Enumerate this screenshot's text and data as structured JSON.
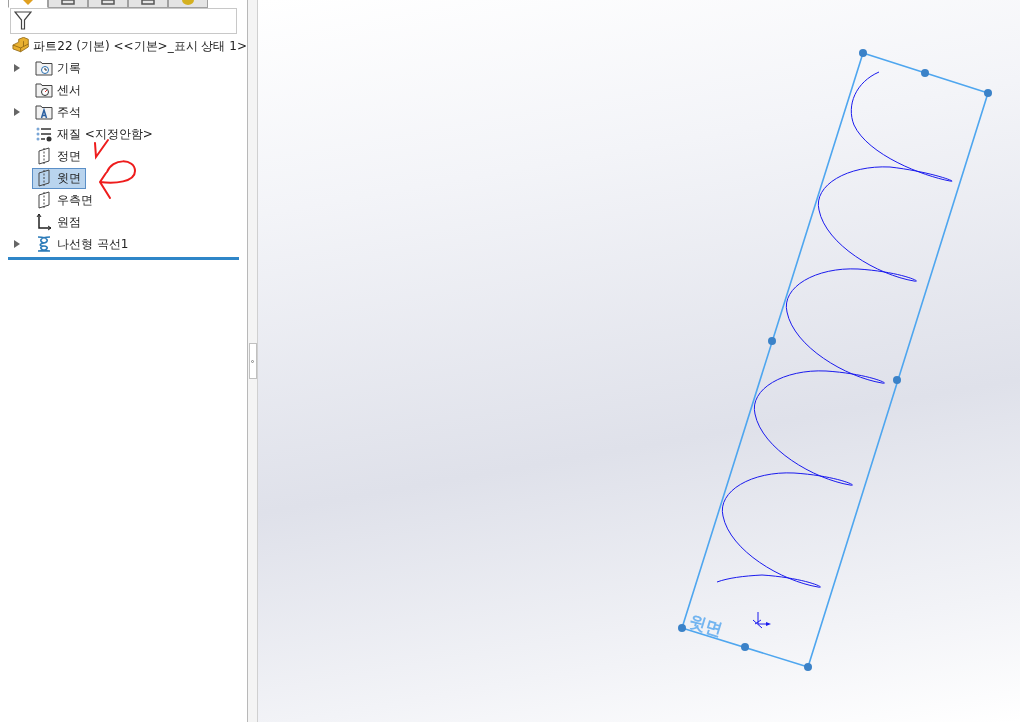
{
  "panel_tabs": [
    {
      "kind": "features",
      "selected": true
    },
    {
      "kind": "properties",
      "selected": false
    },
    {
      "kind": "config",
      "selected": false
    },
    {
      "kind": "dim",
      "selected": false
    },
    {
      "kind": "display",
      "selected": false
    }
  ],
  "tree": {
    "root": {
      "label": "파트22 (기본) <<기본>_표시 상태 1>"
    },
    "items": [
      {
        "label": "기록",
        "kind": "history",
        "expandable": true,
        "selected": false
      },
      {
        "label": "센서",
        "kind": "sensor",
        "expandable": false,
        "selected": false
      },
      {
        "label": "주석",
        "kind": "annotation",
        "expandable": true,
        "selected": false
      },
      {
        "label": "재질 <지정안함>",
        "kind": "material",
        "expandable": false,
        "selected": false
      },
      {
        "label": "정면",
        "kind": "plane",
        "expandable": false,
        "selected": false
      },
      {
        "label": "윗면",
        "kind": "plane",
        "expandable": false,
        "selected": true
      },
      {
        "label": "우측면",
        "kind": "plane",
        "expandable": false,
        "selected": false
      },
      {
        "label": "원점",
        "kind": "origin",
        "expandable": false,
        "selected": false
      },
      {
        "label": "나선형 곡선1",
        "kind": "helix",
        "expandable": true,
        "selected": false
      }
    ]
  },
  "viewport": {
    "plane_label": "윗면"
  }
}
